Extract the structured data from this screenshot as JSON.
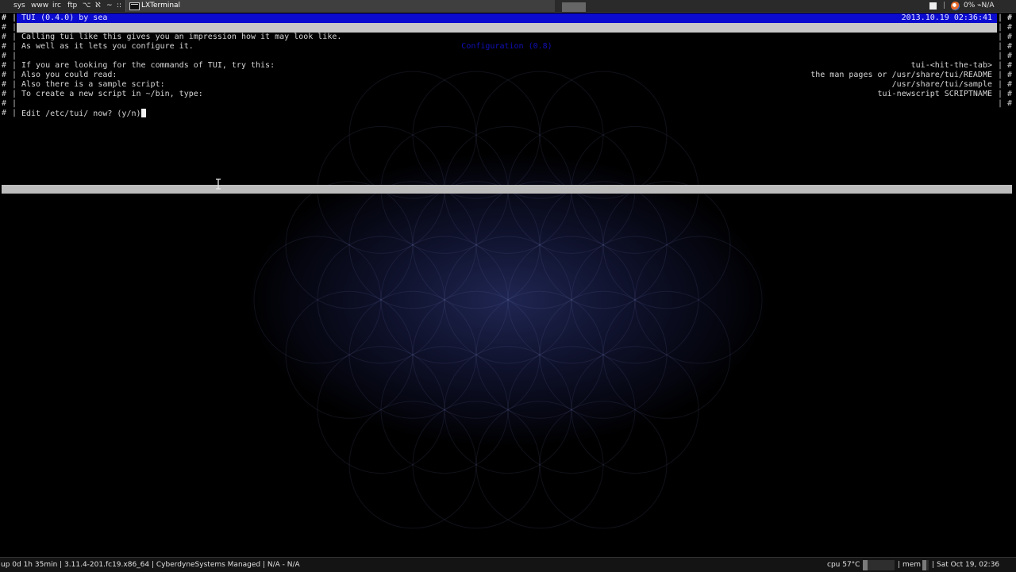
{
  "panel_top": {
    "workspaces": [
      "sys",
      "www",
      "irc",
      "ftp",
      "⌥",
      "ℵ",
      "~",
      "::"
    ],
    "task_label": "LXTerminal",
    "tray_text": "0% ⌁N/A"
  },
  "terminal": {
    "title_left": "TUI (0.4.0) by sea",
    "title_right": "2013.10.19 02:36:41",
    "config_title": "Configuration (0.8)",
    "lines": [
      {
        "left": "Calling tui like this gives you an impression how it may look like.",
        "right": ""
      },
      {
        "left": "As well as it lets you configure it.",
        "right": ""
      },
      {
        "left": "",
        "right": ""
      },
      {
        "left": "If you are looking for the commands of TUI, try this:",
        "right": "tui-<hit-the-tab>"
      },
      {
        "left": "Also you could read:",
        "right": "the man pages or /usr/share/tui/README"
      },
      {
        "left": "Also there is a sample script:",
        "right": "/usr/share/tui/sample"
      },
      {
        "left": "To create a new script in ~/bin, type:",
        "right": "tui-newscript SCRIPTNAME"
      },
      {
        "left": "",
        "right": ""
      }
    ],
    "prompt": "Edit /etc/tui/ now? (y/n)"
  },
  "panel_bottom": {
    "status_left": "up 0d 1h 35min | 3.11.4-201.fc19.x86_64 | CyberdyneSystems Managed | N/A - N/A",
    "cpu_label": "cpu 57°C",
    "cpu_fill": 0.15,
    "mem_label": "mem",
    "mem_fill": 0.6,
    "clock": "Sat Oct 19, 02:36"
  },
  "colors": {
    "title_bar": "#0b0bd0",
    "config_bar": "#c8c8c8",
    "config_text": "#1010b8",
    "background": "#000000"
  }
}
